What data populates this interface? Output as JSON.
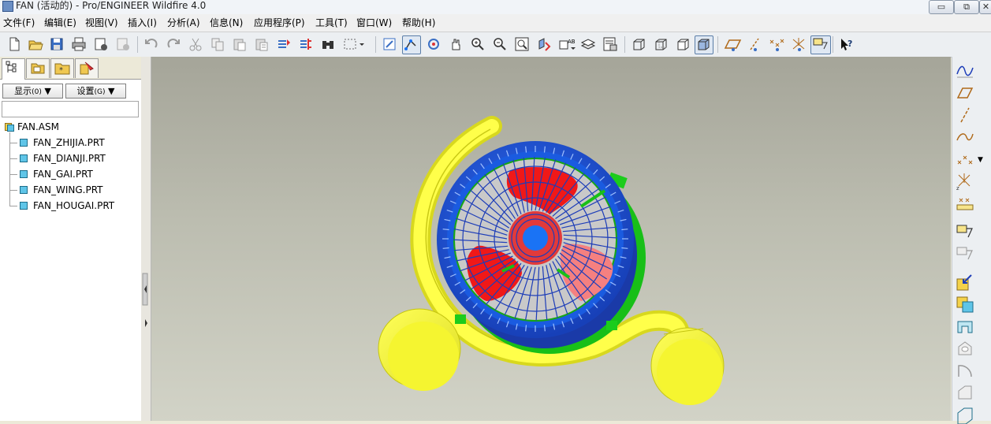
{
  "window": {
    "title": "FAN (活动的) - Pro/ENGINEER Wildfire 4.0",
    "controls": {
      "minimize": "▭",
      "restore": "⧉",
      "close": "✕"
    }
  },
  "menu": [
    "文件(F)",
    "编辑(E)",
    "视图(V)",
    "插入(I)",
    "分析(A)",
    "信息(N)",
    "应用程序(P)",
    "工具(T)",
    "窗口(W)",
    "帮助(H)"
  ],
  "navigator": {
    "show_button": "显示",
    "show_hint": "(0)",
    "settings_button": "设置",
    "settings_hint": "(G)",
    "filter_value": "",
    "tree": {
      "root": "FAN.ASM",
      "parts": [
        "FAN_ZHIJIA.PRT",
        "FAN_DIANJI.PRT",
        "FAN_GAI.PRT",
        "FAN_WING.PRT",
        "FAN_HOUGAI.PRT"
      ]
    }
  },
  "icons": {
    "toolbar": [
      "new-icon",
      "open-icon",
      "save-icon",
      "print-icon",
      "send-mail-icon",
      "send-disabled-icon",
      "undo-icon",
      "redo-icon",
      "cut-icon",
      "copy-icon",
      "paste-icon",
      "paste-special-icon",
      "regenerate-icon",
      "regen-manager-icon",
      "find-icon",
      "select-box-icon",
      "repaint-icon",
      "spin-center-icon",
      "orient-icon",
      "pan-icon",
      "zoom-in-icon",
      "zoom-out-icon",
      "refit-icon",
      "reorient-icon",
      "saved-views-icon",
      "layers-icon",
      "view-manager-icon",
      "wireframe-icon",
      "hidden-line-icon",
      "no-hidden-icon",
      "shading-icon",
      "datum-plane-display-icon",
      "datum-axis-display-icon",
      "datum-point-display-icon",
      "csys-display-icon",
      "annotation-display-icon",
      "whats-this-icon"
    ],
    "right_toolbar": [
      "sketched-curve-icon",
      "datum-plane-icon",
      "datum-axis-icon",
      "datum-curve-icon",
      "datum-point-icon",
      "csys-icon",
      "analysis-feature-icon",
      "annotation-icon",
      "annotation-secondary-icon",
      "component-assemble-icon",
      "component-create-icon",
      "cut-tool-icon",
      "hole-tool-icon",
      "round-tool-icon",
      "chamfer-tool-icon",
      "shell-tool-icon"
    ]
  },
  "colors": {
    "viewport_top": "#a5a599",
    "viewport_bottom": "#d2d3c7",
    "stand": "#f2f23c",
    "front_ring": "#1f5bd8",
    "back_ring": "#1cc41c",
    "blades": "#f01818",
    "hub": "#1a73f5"
  }
}
